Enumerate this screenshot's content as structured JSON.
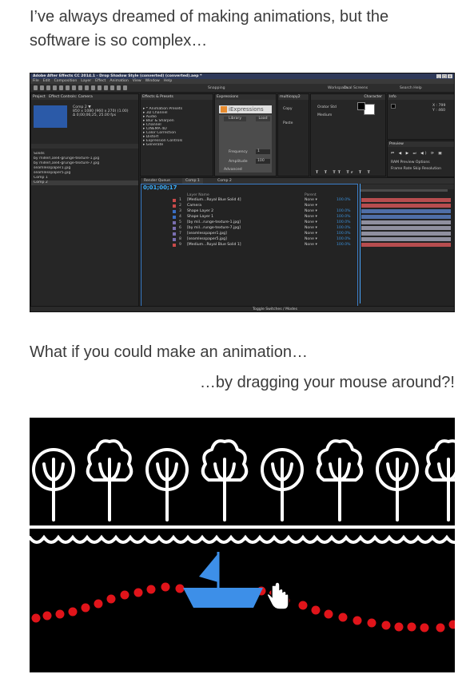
{
  "intro_line1": "I’ve always dreamed of making animations, but the",
  "intro_line2": "software is so complex…",
  "question1": "What if you could make an animation…",
  "question2": "…by dragging your mouse around?!",
  "ae": {
    "window_title": "Adobe After Effects CC 2014.1 - Drop Shadow Style (converted) (converted).aep *",
    "menu": [
      "File",
      "Edit",
      "Composition",
      "Layer",
      "Effect",
      "Animation",
      "View",
      "Window",
      "Help"
    ],
    "snapping_label": "Snapping",
    "workspace_label": "Workspace:",
    "workspace_value": "Dual Screens",
    "search_help": "Search Help",
    "project_tab": "Project",
    "effect_controls_tab": "Effect Controls: Camera",
    "comp_name": "Comp 2 ▼",
    "comp_info_1": "850 x 1080 (960 x 270) (1.00)",
    "comp_info_2": "Δ 0;00;06;25, 25.00 fps",
    "project_items": [
      "Solids",
      "by millerl,ale4-grunge-texture-1.jpg",
      "by millerl,ale4-grunge-texture-7.jpg",
      "seamlesspaper1.jpg",
      "seamlesspaper5.jpg",
      "Comp 1",
      "Comp 2"
    ],
    "effects_presets_tab": "Effects & Presets",
    "effects_list": [
      "* Animation Presets",
      "3D Channel",
      "Audio",
      "Blur & Sharpen",
      "Channel",
      "CINEMA 4D",
      "Color Correction",
      "Distort",
      "Expression Controls",
      "Generate"
    ],
    "expressions_tab": "Expressions",
    "expressions_logo": "iExpressions",
    "library_label": "Library",
    "load_label": "Load",
    "frequency_label": "Frequency",
    "frequency_value": "1",
    "amplitude_label": "Amplitude",
    "amplitude_value": "100",
    "advanced_label": "Advanced",
    "multicopy_tab": "multicopy2",
    "copy_label": "Copy",
    "paste_label": "Paste",
    "character_tab": "Character",
    "font_name": "Orator Std",
    "font_style": "Medium",
    "info_tab": "Info",
    "info_x": "X : 799",
    "info_y": "Y : 460",
    "preview_tab": "Preview",
    "ram_preview": "RAM Preview Options",
    "frame_rate_label": "Frame Rate   Skip   Resolution",
    "render_queue_tab": "Render Queue",
    "comp1_tab": "Comp 1",
    "comp2_tab": "Comp 2",
    "timecode": "0;01;00;17",
    "layer_header_name": "Layer Name",
    "layer_header_mode": "Parent",
    "layers": [
      {
        "num": "1",
        "name": "[Medium...Royal Blue Solid 4]",
        "mode": "None",
        "parent": "100.0%",
        "color": "#c94a4a"
      },
      {
        "num": "2",
        "name": "Camera",
        "mode": "None",
        "parent": "",
        "color": "#c94a4a"
      },
      {
        "num": "3",
        "name": "Shape Layer 2",
        "mode": "None",
        "parent": "100.0%",
        "color": "#3a6fc4"
      },
      {
        "num": "4",
        "name": "Shape Layer 1",
        "mode": "None",
        "parent": "100.0%",
        "color": "#3a6fc4"
      },
      {
        "num": "5",
        "name": "[by mil...runge-texture-1.jpg]",
        "mode": "None",
        "parent": "100.0%",
        "color": "#7a6fb0"
      },
      {
        "num": "6",
        "name": "[by mil...runge-texture-7.jpg]",
        "mode": "None",
        "parent": "100.0%",
        "color": "#7a6fb0"
      },
      {
        "num": "7",
        "name": "[seamlesspaper1.jpg]",
        "mode": "None",
        "parent": "100.0%",
        "color": "#7a6fb0"
      },
      {
        "num": "8",
        "name": "[seamlesspaper5.jpg]",
        "mode": "None",
        "parent": "100.0%",
        "color": "#7a6fb0"
      },
      {
        "num": "9",
        "name": "[Medium...Royal Blue Solid 1]",
        "mode": "None",
        "parent": "100.0%",
        "color": "#c94a4a"
      }
    ],
    "toggle_label": "Toggle Switches / Modes",
    "colors": {
      "bar_red": "#b74d4f",
      "bar_blue": "#4f6fa8",
      "bar_gray": "#8f8f9f",
      "timecode": "#3ab0ff"
    }
  },
  "animation": {
    "colors": {
      "background": "#000000",
      "trees": "#ffffff",
      "boat": "#3d8fe8",
      "dots": "#e0141a",
      "cursor": "#ffffff"
    },
    "scene": "trees-waves-boat",
    "cursor_icon": "hand-pointer-icon"
  }
}
